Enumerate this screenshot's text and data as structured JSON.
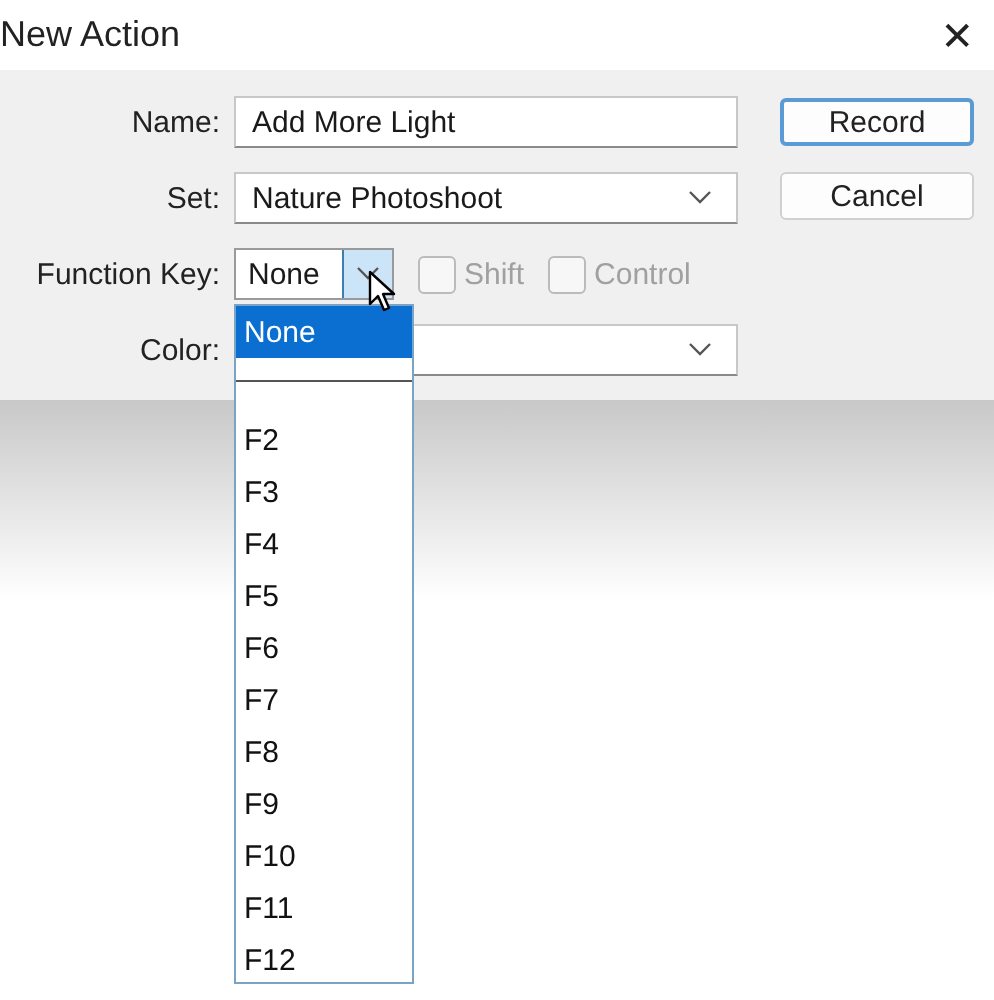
{
  "window": {
    "title": "New Action",
    "close": "✕"
  },
  "fields": [
    {
      "kind": "text",
      "label": "Name:",
      "value": "Add More Light"
    },
    {
      "kind": "select",
      "label": "Set:",
      "value": "Nature Photoshoot"
    }
  ],
  "function_key": {
    "label": "Function Key:",
    "value": "None",
    "expanded": true,
    "options": [
      {
        "kind": "option",
        "label": "None",
        "selected": true
      },
      {
        "kind": "blank"
      },
      {
        "kind": "separator"
      },
      {
        "kind": "option",
        "label": "F2",
        "selected": false
      },
      {
        "kind": "option",
        "label": "F3",
        "selected": false
      },
      {
        "kind": "option",
        "label": "F4",
        "selected": false
      },
      {
        "kind": "option",
        "label": "F5",
        "selected": false
      },
      {
        "kind": "option",
        "label": "F6",
        "selected": false
      },
      {
        "kind": "option",
        "label": "F7",
        "selected": false
      },
      {
        "kind": "option",
        "label": "F8",
        "selected": false
      },
      {
        "kind": "option",
        "label": "F9",
        "selected": false
      },
      {
        "kind": "option",
        "label": "F10",
        "selected": false
      },
      {
        "kind": "option",
        "label": "F11",
        "selected": false
      },
      {
        "kind": "option",
        "label": "F12",
        "selected": false
      }
    ]
  },
  "modifiers": [
    {
      "label": "Shift",
      "checked": false,
      "disabled": true
    },
    {
      "label": "Control",
      "checked": false,
      "disabled": true
    }
  ],
  "color": {
    "label": "Color:"
  },
  "buttons": [
    {
      "label": "Record",
      "default": true
    },
    {
      "label": "Cancel",
      "default": false
    }
  ]
}
